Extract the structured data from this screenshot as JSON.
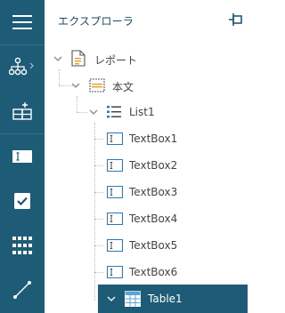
{
  "sidebar": {
    "buttons": [
      {
        "name": "menu-icon"
      },
      {
        "name": "hierarchy-icon"
      },
      {
        "name": "add-element-icon"
      },
      {
        "name": "textbox-tool-icon"
      },
      {
        "name": "checkbox-tool-icon"
      },
      {
        "name": "table-tool-icon"
      },
      {
        "name": "line-tool-icon"
      }
    ]
  },
  "explorer": {
    "title": "エクスプローラ",
    "pin_icon": "pin-icon"
  },
  "tree": {
    "report": "レポート",
    "body": "本文",
    "list": "List1",
    "textboxes": [
      "TextBox1",
      "TextBox2",
      "TextBox3",
      "TextBox4",
      "TextBox5",
      "TextBox6"
    ],
    "table": "Table1"
  },
  "colors": {
    "sidebar_bg": "#1e5b76",
    "selected_bg": "#1e5b76",
    "accent_blue": "#2a7ab8"
  }
}
